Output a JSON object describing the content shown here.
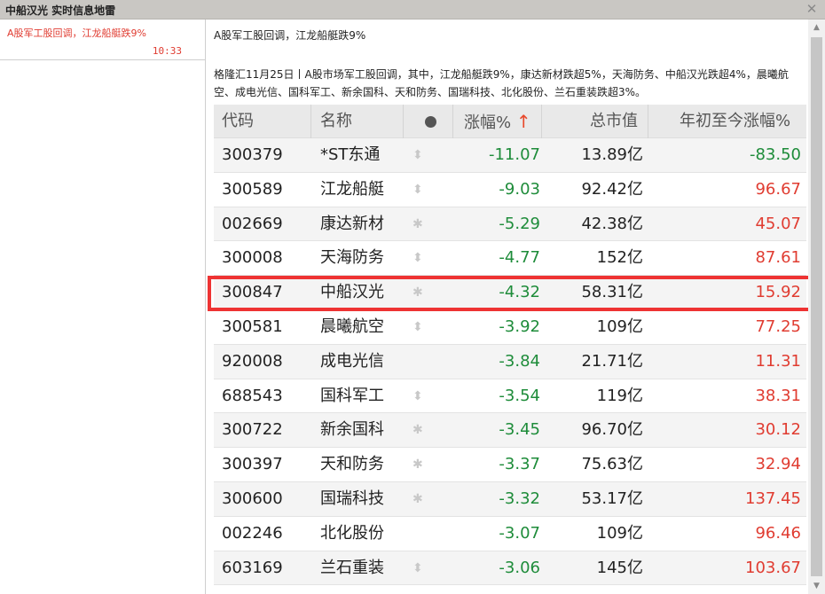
{
  "window": {
    "title": "中船汉光 实时信息地雷",
    "close_icon": "close-icon"
  },
  "news_list": [
    {
      "headline": "A股军工股回调，江龙船艇跌9%",
      "time": "10:33"
    }
  ],
  "article": {
    "title": "A股军工股回调，江龙船艇跌9%",
    "body": "格隆汇11月25日丨A股市场军工股回调，其中，江龙船艇跌9%，康达新材跌超5%，天海防务、中船汉光跌超4%，晨曦航空、成电光信、国科军工、新余国科、天和防务、国瑞科技、北化股份、兰石重装跌超3%。"
  },
  "table": {
    "headers": {
      "code": "代码",
      "name": "名称",
      "pct": "涨幅%",
      "pct_sort_arrow": "↑",
      "cap": "总市值",
      "ytd": "年初至今涨幅%"
    },
    "rows": [
      {
        "code": "300379",
        "name": "*ST东通",
        "icon": "⬍",
        "pct": "-11.07",
        "cap": "13.89亿",
        "ytd": "-83.50",
        "ytd_color": "#1e8c3a"
      },
      {
        "code": "300589",
        "name": "江龙船艇",
        "icon": "⬍",
        "pct": "-9.03",
        "cap": "92.42亿",
        "ytd": "96.67",
        "ytd_color": "#e03c31"
      },
      {
        "code": "002669",
        "name": "康达新材",
        "icon": "✱",
        "pct": "-5.29",
        "cap": "42.38亿",
        "ytd": "45.07",
        "ytd_color": "#e03c31"
      },
      {
        "code": "300008",
        "name": "天海防务",
        "icon": "⬍",
        "pct": "-4.77",
        "cap": "152亿",
        "ytd": "87.61",
        "ytd_color": "#e03c31"
      },
      {
        "code": "300847",
        "name": "中船汉光",
        "icon": "✱",
        "pct": "-4.32",
        "cap": "58.31亿",
        "ytd": "15.92",
        "ytd_color": "#e03c31"
      },
      {
        "code": "300581",
        "name": "晨曦航空",
        "icon": "⬍",
        "pct": "-3.92",
        "cap": "109亿",
        "ytd": "77.25",
        "ytd_color": "#e03c31"
      },
      {
        "code": "920008",
        "name": "成电光信",
        "icon": "",
        "pct": "-3.84",
        "cap": "21.71亿",
        "ytd": "11.31",
        "ytd_color": "#e03c31"
      },
      {
        "code": "688543",
        "name": "国科军工",
        "icon": "⬍",
        "pct": "-3.54",
        "cap": "119亿",
        "ytd": "38.31",
        "ytd_color": "#e03c31"
      },
      {
        "code": "300722",
        "name": "新余国科",
        "icon": "✱",
        "pct": "-3.45",
        "cap": "96.70亿",
        "ytd": "30.12",
        "ytd_color": "#e03c31"
      },
      {
        "code": "300397",
        "name": "天和防务",
        "icon": "✱",
        "pct": "-3.37",
        "cap": "75.63亿",
        "ytd": "32.94",
        "ytd_color": "#e03c31"
      },
      {
        "code": "300600",
        "name": "国瑞科技",
        "icon": "✱",
        "pct": "-3.32",
        "cap": "53.17亿",
        "ytd": "137.45",
        "ytd_color": "#e03c31"
      },
      {
        "code": "002246",
        "name": "北化股份",
        "icon": "",
        "pct": "-3.07",
        "cap": "109亿",
        "ytd": "96.46",
        "ytd_color": "#e03c31"
      },
      {
        "code": "603169",
        "name": "兰石重装",
        "icon": "⬍",
        "pct": "-3.06",
        "cap": "145亿",
        "ytd": "103.67",
        "ytd_color": "#e03c31"
      }
    ]
  },
  "colors": {
    "down_green": "#1e8c3a",
    "up_red": "#e03c31",
    "highlight_border": "#ee3333"
  }
}
